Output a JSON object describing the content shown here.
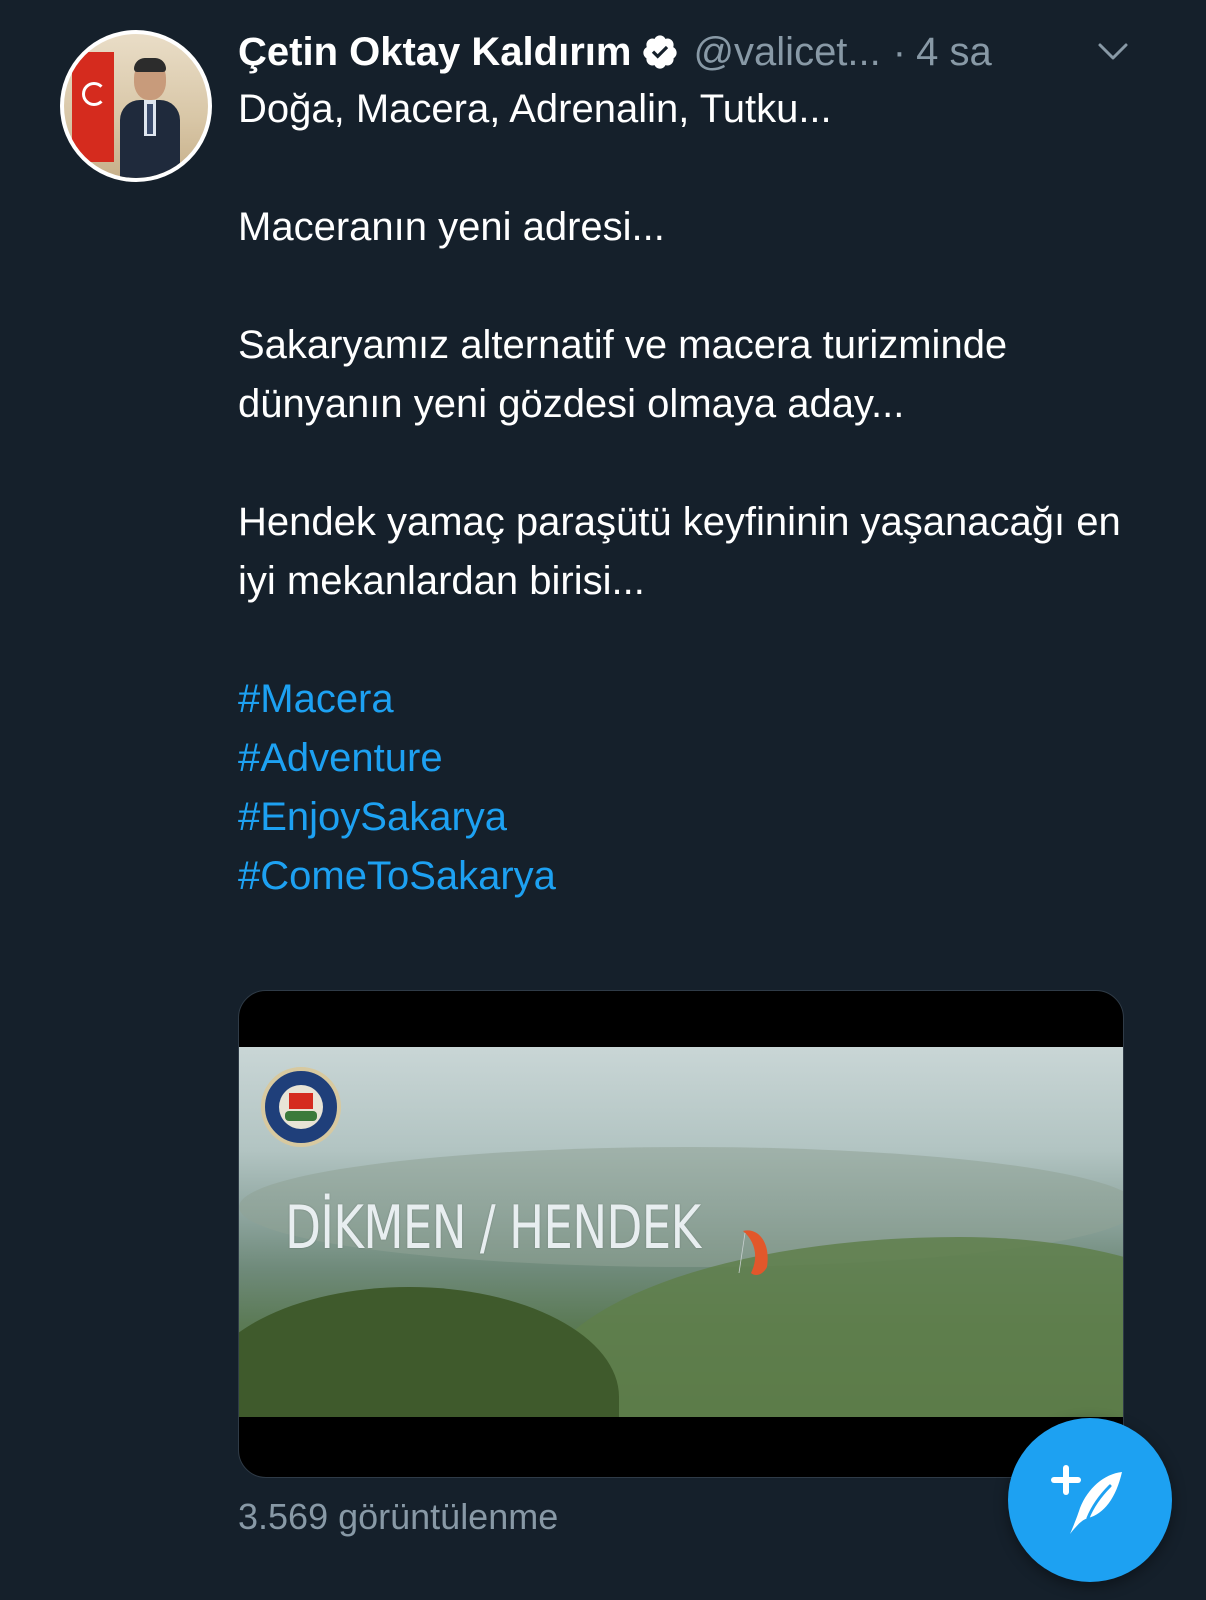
{
  "tweet": {
    "author_name": "Çetin Oktay Kaldırım",
    "handle": "@valicet...",
    "separator": "·",
    "time": "4 sa",
    "paragraphs": [
      "Doğa, Macera, Adrenalin, Tutku...",
      "Maceranın yeni adresi...",
      "Sakaryamız alternatif ve macera turizminde dünyanın yeni gözdesi olmaya aday...",
      "Hendek yamaç paraşütü keyfininin yaşanacağı en iyi mekanlardan birisi..."
    ],
    "hashtags": [
      "#Macera",
      "#Adventure",
      "#EnjoySakarya",
      "#ComeToSakarya"
    ],
    "media": {
      "overlay_title": "DİKMEN / HENDEK"
    },
    "views": "3.569 görüntülenme"
  },
  "icons": {
    "verified": "verified-badge-icon",
    "chevron": "chevron-down-icon",
    "compose": "compose-tweet-icon"
  },
  "colors": {
    "background": "#15202b",
    "accent": "#1da1f2",
    "secondary_text": "#8899a6",
    "primary_text": "#ffffff"
  }
}
